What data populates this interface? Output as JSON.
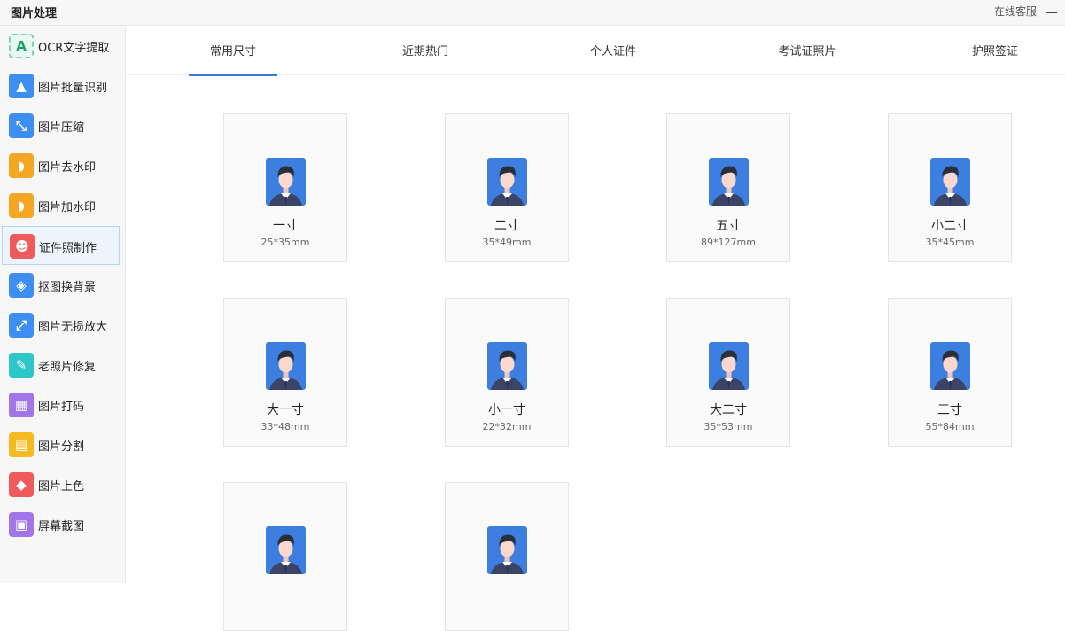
{
  "app": {
    "title": "图片处理",
    "support": "在线客服"
  },
  "sidebar": {
    "items": [
      {
        "label": "OCR文字提取",
        "icon": "ocr-text-icon",
        "color": "#e9f7f2"
      },
      {
        "label": "图片批量识别",
        "icon": "image-batch-icon",
        "color": "#3d8ef0"
      },
      {
        "label": "图片压缩",
        "icon": "compress-icon",
        "color": "#3d8ef0"
      },
      {
        "label": "图片去水印",
        "icon": "remove-watermark-icon",
        "color": "#f5a623"
      },
      {
        "label": "图片加水印",
        "icon": "add-watermark-icon",
        "color": "#f5a623"
      },
      {
        "label": "证件照制作",
        "icon": "id-photo-icon",
        "color": "#ef5a5a"
      },
      {
        "label": "抠图换背景",
        "icon": "cutout-icon",
        "color": "#3d8ef0"
      },
      {
        "label": "图片无损放大",
        "icon": "enlarge-icon",
        "color": "#3d8ef0"
      },
      {
        "label": "老照片修复",
        "icon": "repair-icon",
        "color": "#2ec7c9"
      },
      {
        "label": "图片打码",
        "icon": "mosaic-icon",
        "color": "#a076e8"
      },
      {
        "label": "图片分割",
        "icon": "split-icon",
        "color": "#f5b921"
      },
      {
        "label": "图片上色",
        "icon": "colorize-icon",
        "color": "#ef5a5a"
      },
      {
        "label": "屏幕截图",
        "icon": "screenshot-icon",
        "color": "#a076e8"
      }
    ],
    "active_index": 5
  },
  "tabs": [
    {
      "label": "常用尺寸"
    },
    {
      "label": "近期热门"
    },
    {
      "label": "个人证件"
    },
    {
      "label": "考试证照片"
    },
    {
      "label": "护照签证"
    }
  ],
  "active_tab": 0,
  "sizes": [
    {
      "name": "一寸",
      "size": "25*35mm"
    },
    {
      "name": "二寸",
      "size": "35*49mm"
    },
    {
      "name": "五寸",
      "size": "89*127mm"
    },
    {
      "name": "小二寸",
      "size": "35*45mm"
    },
    {
      "name": "大一寸",
      "size": "33*48mm"
    },
    {
      "name": "小一寸",
      "size": "22*32mm"
    },
    {
      "name": "大二寸",
      "size": "35*53mm"
    },
    {
      "name": "三寸",
      "size": "55*84mm"
    },
    {
      "name": "",
      "size": ""
    },
    {
      "name": "",
      "size": ""
    }
  ],
  "colors": {
    "accent": "#3a7bd5",
    "avatar_bg": "#3d7fe0"
  }
}
